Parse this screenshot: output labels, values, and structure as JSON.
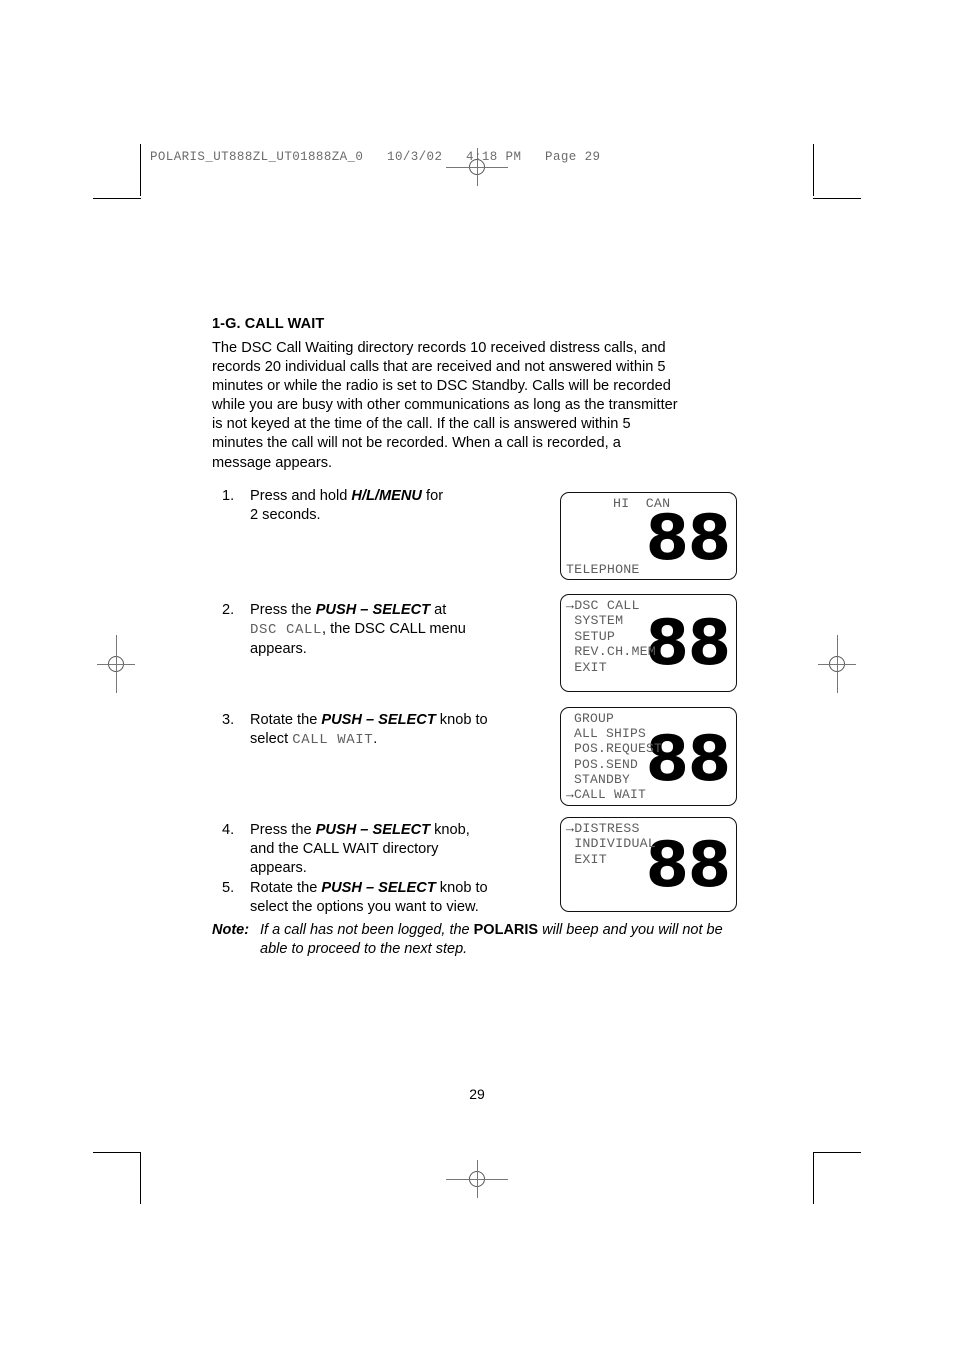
{
  "printer_header": {
    "text": "POLARIS_UT888ZL_UT01888ZA_0   10/3/02   4:18 PM   Page 29"
  },
  "section": {
    "title": "1-G. CALL WAIT",
    "intro": "The DSC Call Waiting directory records 10 received distress calls, and\nrecords 20 individual calls that are received and not answered within 5\nminutes or while the radio is set to DSC Standby.  Calls will be recorded\nwhile you are busy with other communications as long as the transmitter\nis not keyed at the time of the call.  If the call is answered within 5\nminutes the call will not be recorded.  When a call is recorded, a\nmessage appears."
  },
  "steps": [
    {
      "number": "1.",
      "part1": "Press and hold ",
      "bold1": "H/L/MENU",
      "part2": " for",
      "line2": "2 seconds."
    },
    {
      "number": "2.",
      "part1": "Press the ",
      "bold1": "PUSH – SELECT",
      "part2": " at",
      "lcd_text": "DSC CALL",
      "part3": ", the DSC CALL menu",
      "line3": "appears."
    },
    {
      "number": "3.",
      "part1": "Rotate the ",
      "bold1": "PUSH – SELECT",
      "part2": " knob to",
      "line2_pre": "select ",
      "lcd_text": "CALL WAIT",
      "line2_post": "."
    },
    {
      "number": "4.",
      "part1": "Press the ",
      "bold1": "PUSH – SELECT",
      "part2": " knob,",
      "line2": "and the CALL WAIT directory",
      "line3": "appears."
    },
    {
      "number": "5.",
      "part1": "Rotate the ",
      "bold1": "PUSH – SELECT",
      "part2": " knob to",
      "line2": "select the options you want to view."
    }
  ],
  "displays": [
    {
      "name": "telephone-standby-display",
      "top_label": "HI  CAN",
      "big_digits": "88",
      "bottom_label": "TELEPHONE",
      "menu_items": []
    },
    {
      "name": "main-menu-display",
      "big_digits": "88",
      "menu_items": [
        {
          "pointer": true,
          "label": "DSC CALL"
        },
        {
          "pointer": false,
          "label": "SYSTEM"
        },
        {
          "pointer": false,
          "label": "SETUP"
        },
        {
          "pointer": false,
          "label": "REV.CH.MEM"
        },
        {
          "pointer": false,
          "label": "EXIT"
        }
      ]
    },
    {
      "name": "dsc-call-menu-display",
      "big_digits": "88",
      "menu_items": [
        {
          "pointer": false,
          "label": "GROUP"
        },
        {
          "pointer": false,
          "label": "ALL SHIPS"
        },
        {
          "pointer": false,
          "label": "POS.REQUEST"
        },
        {
          "pointer": false,
          "label": "POS.SEND"
        },
        {
          "pointer": false,
          "label": "STANDBY"
        },
        {
          "pointer": true,
          "label": "CALL WAIT"
        }
      ]
    },
    {
      "name": "call-wait-directory-display",
      "big_digits": "88",
      "menu_items": [
        {
          "pointer": true,
          "label": "DISTRESS"
        },
        {
          "pointer": false,
          "label": "INDIVIDUAL"
        },
        {
          "pointer": false,
          "label": "EXIT"
        }
      ]
    }
  ],
  "note": {
    "label": "Note:",
    "part1": "If a call has not been logged, the ",
    "bold1": "POLARIS",
    "part2": " will beep and you will not be able to proceed to the next step."
  },
  "page_number": "29",
  "colors": {
    "page_background": "#ffffff",
    "text": "#000000",
    "printer_header": "#6b6b6b",
    "lcd_menu_text": "#5e5e5e",
    "lcd_border": "#111111"
  }
}
